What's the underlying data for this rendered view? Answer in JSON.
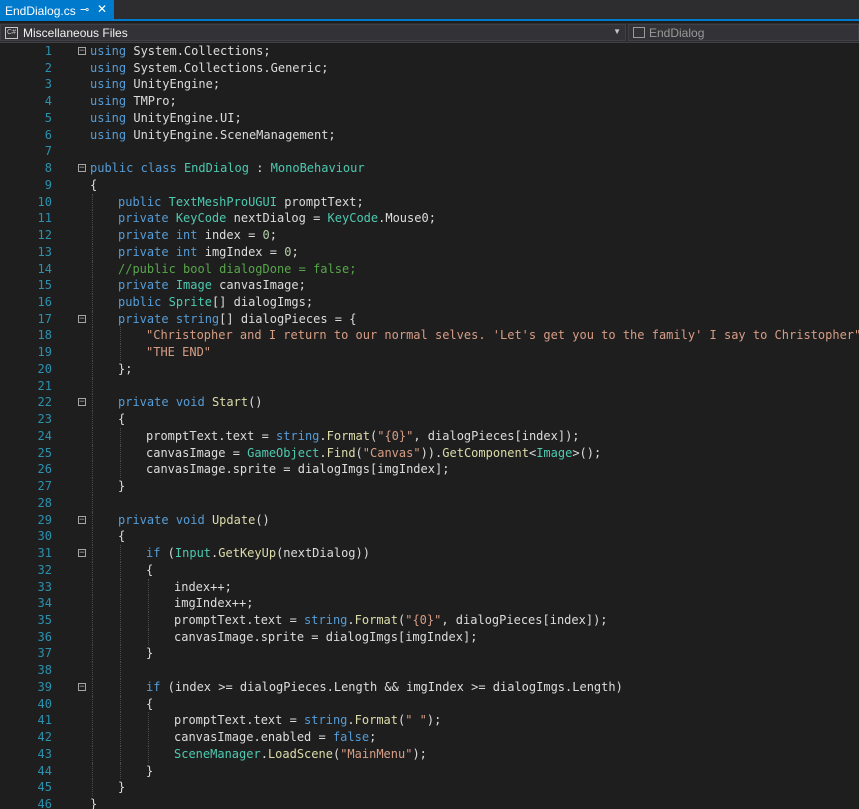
{
  "tab": {
    "title": "EndDialog.cs",
    "pin_glyph": "⊸",
    "close_glyph": "✕"
  },
  "nav": {
    "project_label": "Miscellaneous Files",
    "class_label": "EndDialog",
    "project_icon": "csharp-file-icon",
    "class_icon": "class-icon"
  },
  "code_lines": [
    {
      "n": "1",
      "fold": "minus",
      "indent": 0,
      "tokens": [
        [
          "kw",
          "using"
        ],
        [
          "t",
          " System.Collections;"
        ]
      ]
    },
    {
      "n": "2",
      "indent": 0,
      "tokens": [
        [
          "kw",
          "using"
        ],
        [
          "t",
          " System.Collections.Generic;"
        ]
      ]
    },
    {
      "n": "3",
      "indent": 0,
      "tokens": [
        [
          "kw",
          "using"
        ],
        [
          "t",
          " UnityEngine;"
        ]
      ]
    },
    {
      "n": "4",
      "indent": 0,
      "tokens": [
        [
          "kw",
          "using"
        ],
        [
          "t",
          " TMPro;"
        ]
      ]
    },
    {
      "n": "5",
      "indent": 0,
      "tokens": [
        [
          "kw",
          "using"
        ],
        [
          "t",
          " UnityEngine.UI;"
        ]
      ]
    },
    {
      "n": "6",
      "indent": 0,
      "tokens": [
        [
          "kw",
          "using"
        ],
        [
          "t",
          " UnityEngine.SceneManagement;"
        ]
      ]
    },
    {
      "n": "7",
      "indent": 0,
      "tokens": []
    },
    {
      "n": "8",
      "fold": "minus",
      "indent": 0,
      "tokens": [
        [
          "kw",
          "public"
        ],
        [
          "t",
          " "
        ],
        [
          "kw",
          "class"
        ],
        [
          "t",
          " "
        ],
        [
          "ty",
          "EndDialog"
        ],
        [
          "t",
          " : "
        ],
        [
          "ty",
          "MonoBehaviour"
        ]
      ]
    },
    {
      "n": "9",
      "indent": 0,
      "tokens": [
        [
          "t",
          "{"
        ]
      ]
    },
    {
      "n": "10",
      "indent": 1,
      "tokens": [
        [
          "kw",
          "public"
        ],
        [
          "t",
          " "
        ],
        [
          "ty",
          "TextMeshProUGUI"
        ],
        [
          "t",
          " promptText;"
        ]
      ]
    },
    {
      "n": "11",
      "indent": 1,
      "tokens": [
        [
          "kw",
          "private"
        ],
        [
          "t",
          " "
        ],
        [
          "ty",
          "KeyCode"
        ],
        [
          "t",
          " nextDialog = "
        ],
        [
          "ty",
          "KeyCode"
        ],
        [
          "t",
          ".Mouse0;"
        ]
      ]
    },
    {
      "n": "12",
      "indent": 1,
      "tokens": [
        [
          "kw",
          "private"
        ],
        [
          "t",
          " "
        ],
        [
          "kw",
          "int"
        ],
        [
          "t",
          " index = "
        ],
        [
          "nm",
          "0"
        ],
        [
          "t",
          ";"
        ]
      ]
    },
    {
      "n": "13",
      "indent": 1,
      "tokens": [
        [
          "kw",
          "private"
        ],
        [
          "t",
          " "
        ],
        [
          "kw",
          "int"
        ],
        [
          "t",
          " imgIndex = "
        ],
        [
          "nm",
          "0"
        ],
        [
          "t",
          ";"
        ]
      ]
    },
    {
      "n": "14",
      "indent": 1,
      "tokens": [
        [
          "cm",
          "//public bool dialogDone = false;"
        ]
      ]
    },
    {
      "n": "15",
      "indent": 1,
      "tokens": [
        [
          "kw",
          "private"
        ],
        [
          "t",
          " "
        ],
        [
          "ty",
          "Image"
        ],
        [
          "t",
          " canvasImage;"
        ]
      ]
    },
    {
      "n": "16",
      "indent": 1,
      "tokens": [
        [
          "kw",
          "public"
        ],
        [
          "t",
          " "
        ],
        [
          "ty",
          "Sprite"
        ],
        [
          "t",
          "[] dialogImgs;"
        ]
      ]
    },
    {
      "n": "17",
      "fold": "minus",
      "indent": 1,
      "tokens": [
        [
          "kw",
          "private"
        ],
        [
          "t",
          " "
        ],
        [
          "kw",
          "string"
        ],
        [
          "t",
          "[] dialogPieces = {"
        ]
      ]
    },
    {
      "n": "18",
      "indent": 2,
      "tokens": [
        [
          "st",
          "\"Christopher and I return to our normal selves. 'Let's get you to the family' I say to Christopher\""
        ],
        [
          "t",
          ","
        ]
      ]
    },
    {
      "n": "19",
      "indent": 2,
      "tokens": [
        [
          "st",
          "\"THE END\""
        ]
      ]
    },
    {
      "n": "20",
      "indent": 1,
      "tokens": [
        [
          "t",
          "};"
        ]
      ]
    },
    {
      "n": "21",
      "indent": 1,
      "tokens": []
    },
    {
      "n": "22",
      "fold": "minus",
      "indent": 1,
      "tokens": [
        [
          "kw",
          "private"
        ],
        [
          "t",
          " "
        ],
        [
          "kw",
          "void"
        ],
        [
          "t",
          " "
        ],
        [
          "fn",
          "Start"
        ],
        [
          "t",
          "()"
        ]
      ]
    },
    {
      "n": "23",
      "indent": 1,
      "tokens": [
        [
          "t",
          "{"
        ]
      ]
    },
    {
      "n": "24",
      "indent": 2,
      "tokens": [
        [
          "t",
          "promptText.text = "
        ],
        [
          "kw",
          "string"
        ],
        [
          "t",
          "."
        ],
        [
          "fn",
          "Format"
        ],
        [
          "t",
          "("
        ],
        [
          "st",
          "\"{0}\""
        ],
        [
          "t",
          ", dialogPieces[index]);"
        ]
      ]
    },
    {
      "n": "25",
      "indent": 2,
      "tokens": [
        [
          "t",
          "canvasImage = "
        ],
        [
          "ty",
          "GameObject"
        ],
        [
          "t",
          "."
        ],
        [
          "fn",
          "Find"
        ],
        [
          "t",
          "("
        ],
        [
          "st",
          "\"Canvas\""
        ],
        [
          "t",
          "))."
        ],
        [
          "fn",
          "GetComponent"
        ],
        [
          "t",
          "<"
        ],
        [
          "ty",
          "Image"
        ],
        [
          "t",
          ">();"
        ]
      ]
    },
    {
      "n": "26",
      "indent": 2,
      "tokens": [
        [
          "t",
          "canvasImage.sprite = dialogImgs[imgIndex];"
        ]
      ]
    },
    {
      "n": "27",
      "indent": 1,
      "tokens": [
        [
          "t",
          "}"
        ]
      ]
    },
    {
      "n": "28",
      "indent": 1,
      "tokens": []
    },
    {
      "n": "29",
      "fold": "minus",
      "indent": 1,
      "tokens": [
        [
          "kw",
          "private"
        ],
        [
          "t",
          " "
        ],
        [
          "kw",
          "void"
        ],
        [
          "t",
          " "
        ],
        [
          "fn",
          "Update"
        ],
        [
          "t",
          "()"
        ]
      ]
    },
    {
      "n": "30",
      "indent": 1,
      "tokens": [
        [
          "t",
          "{"
        ]
      ]
    },
    {
      "n": "31",
      "fold": "minus",
      "indent": 2,
      "tokens": [
        [
          "kw",
          "if"
        ],
        [
          "t",
          " ("
        ],
        [
          "ty",
          "Input"
        ],
        [
          "t",
          "."
        ],
        [
          "fn",
          "GetKeyUp"
        ],
        [
          "t",
          "(nextDialog))"
        ]
      ]
    },
    {
      "n": "32",
      "indent": 2,
      "tokens": [
        [
          "t",
          "{"
        ]
      ]
    },
    {
      "n": "33",
      "indent": 3,
      "tokens": [
        [
          "t",
          "index++;"
        ]
      ]
    },
    {
      "n": "34",
      "indent": 3,
      "tokens": [
        [
          "t",
          "imgIndex++;"
        ]
      ]
    },
    {
      "n": "35",
      "indent": 3,
      "tokens": [
        [
          "t",
          "promptText.text = "
        ],
        [
          "kw",
          "string"
        ],
        [
          "t",
          "."
        ],
        [
          "fn",
          "Format"
        ],
        [
          "t",
          "("
        ],
        [
          "st",
          "\"{0}\""
        ],
        [
          "t",
          ", dialogPieces[index]);"
        ]
      ]
    },
    {
      "n": "36",
      "indent": 3,
      "tokens": [
        [
          "t",
          "canvasImage.sprite = dialogImgs[imgIndex];"
        ]
      ]
    },
    {
      "n": "37",
      "indent": 2,
      "tokens": [
        [
          "t",
          "}"
        ]
      ]
    },
    {
      "n": "38",
      "indent": 2,
      "tokens": []
    },
    {
      "n": "39",
      "fold": "minus",
      "indent": 2,
      "tokens": [
        [
          "kw",
          "if"
        ],
        [
          "t",
          " (index >= dialogPieces.Length && imgIndex >= dialogImgs.Length)"
        ]
      ]
    },
    {
      "n": "40",
      "indent": 2,
      "tokens": [
        [
          "t",
          "{"
        ]
      ]
    },
    {
      "n": "41",
      "indent": 3,
      "tokens": [
        [
          "t",
          "promptText.text = "
        ],
        [
          "kw",
          "string"
        ],
        [
          "t",
          "."
        ],
        [
          "fn",
          "Format"
        ],
        [
          "t",
          "("
        ],
        [
          "st",
          "\" \""
        ],
        [
          "t",
          ");"
        ]
      ]
    },
    {
      "n": "42",
      "indent": 3,
      "tokens": [
        [
          "t",
          "canvasImage.enabled = "
        ],
        [
          "kw",
          "false"
        ],
        [
          "t",
          ";"
        ]
      ]
    },
    {
      "n": "43",
      "indent": 3,
      "tokens": [
        [
          "ty",
          "SceneManager"
        ],
        [
          "t",
          "."
        ],
        [
          "fn",
          "LoadScene"
        ],
        [
          "t",
          "("
        ],
        [
          "st",
          "\"MainMenu\""
        ],
        [
          "t",
          ");"
        ]
      ]
    },
    {
      "n": "44",
      "indent": 2,
      "tokens": [
        [
          "t",
          "}"
        ]
      ]
    },
    {
      "n": "45",
      "indent": 1,
      "tokens": [
        [
          "t",
          "}"
        ]
      ]
    },
    {
      "n": "46",
      "indent": 0,
      "tokens": [
        [
          "t",
          "}"
        ]
      ]
    }
  ],
  "colors": {
    "background": "#1e1e1e",
    "keyword": "#569cd6",
    "type": "#4ec9b0",
    "string": "#d69d85",
    "comment": "#57a64a",
    "number": "#b5cea8",
    "line_number": "#2b91af",
    "accent": "#007acc"
  }
}
